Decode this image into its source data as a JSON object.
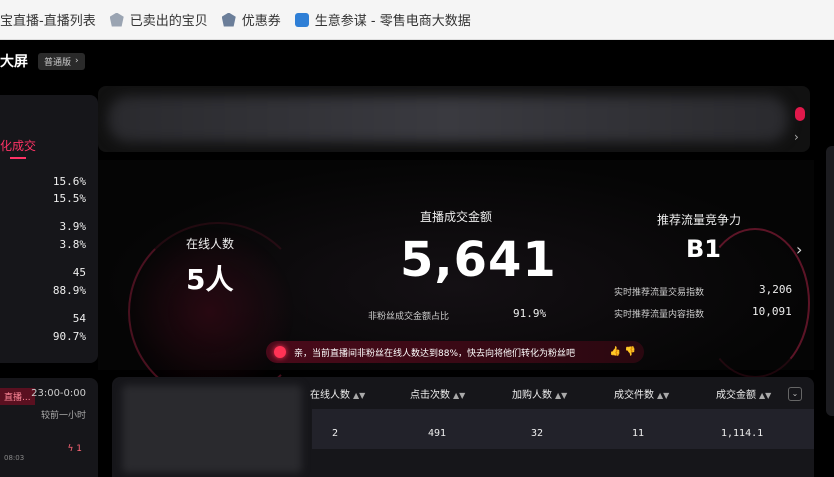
{
  "bookmarks": [
    {
      "label": "宝直播-直播列表",
      "icon": "none"
    },
    {
      "label": "已卖出的宝贝",
      "icon": "shopping-cart-icon"
    },
    {
      "label": "优惠券",
      "icon": "shopping-bag-icon"
    },
    {
      "label": "生意参谋 - 零售电商大数据",
      "icon": "canon-icon"
    }
  ],
  "header": {
    "title": "大屏",
    "version": "普通版"
  },
  "left_panel": {
    "tab": "化成交",
    "values": [
      "15.6%",
      "15.5%",
      "3.9%",
      "3.8%",
      "45",
      "88.9%",
      "54",
      "90.7%"
    ]
  },
  "left_bottom": {
    "badge": "直播...",
    "time": "23:00-0:00",
    "sub": "较前一小时",
    "indicator": "1",
    "date": "08:03"
  },
  "stats": {
    "online_label": "在线人数",
    "online_value": "5人",
    "gmv_label": "直播成交金额",
    "gmv_value": "5,641",
    "nonfan_label": "非粉丝成交金额占比",
    "nonfan_value": "91.9%",
    "rank_label": "推荐流量竞争力",
    "rank_value": "B1",
    "rec_trade_label": "实时推荐流量交易指数",
    "rec_trade_value": "3,206",
    "rec_content_label": "实时推荐流量内容指数",
    "rec_content_value": "10,091"
  },
  "tip": {
    "text": "亲，当前直播间非粉丝在线人数达到88%，快去向将他们转化为粉丝吧"
  },
  "table": {
    "columns": [
      "在线人数",
      "点击次数",
      "加购人数",
      "成交件数",
      "成交金额"
    ],
    "row": [
      "2",
      "491",
      "32",
      "11",
      "1,114.1"
    ]
  }
}
